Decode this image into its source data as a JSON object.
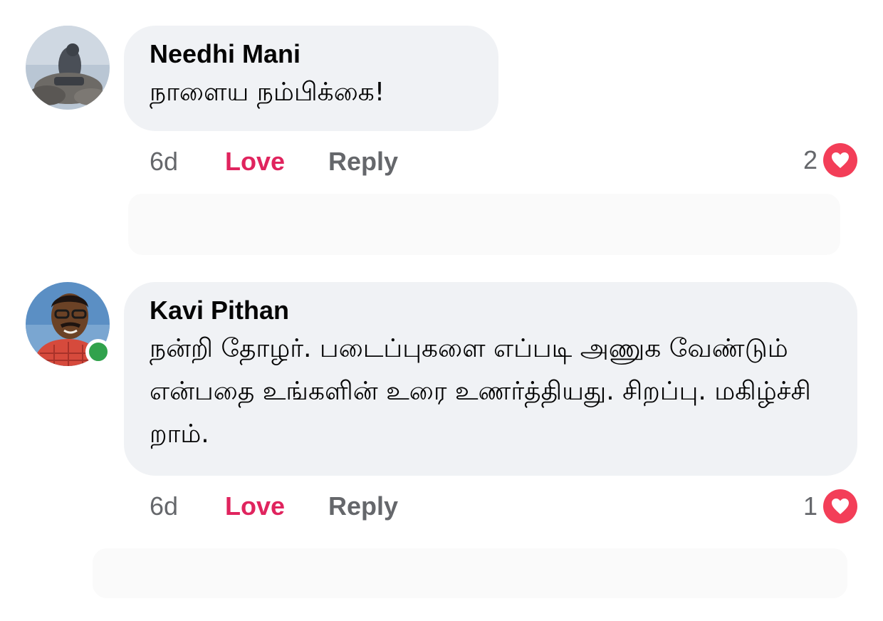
{
  "comments": [
    {
      "author": "Needhi Mani",
      "text": "நாளைய நம்பிக்கை!",
      "time": "6d",
      "love_label": "Love",
      "reply_label": "Reply",
      "reaction_count": "2",
      "reaction_icon": "heart-icon",
      "online": false
    },
    {
      "author": "Kavi Pithan",
      "text": "நன்றி தோழர். படைப்புகளை எப்படி அணுக வேண்டும் என்பதை உங்களின் உரை உணர்த்தியது. சிறப்பு. மகிழ்ச்சி றாம்.",
      "time": "6d",
      "love_label": "Love",
      "reply_label": "Reply",
      "reaction_count": "1",
      "reaction_icon": "heart-icon",
      "online": true
    }
  ],
  "colors": {
    "bubble": "#f0f2f5",
    "love": "#e0245e",
    "reaction_heart": "#f33e58",
    "online": "#31a24c",
    "meta_text": "#65676b"
  }
}
